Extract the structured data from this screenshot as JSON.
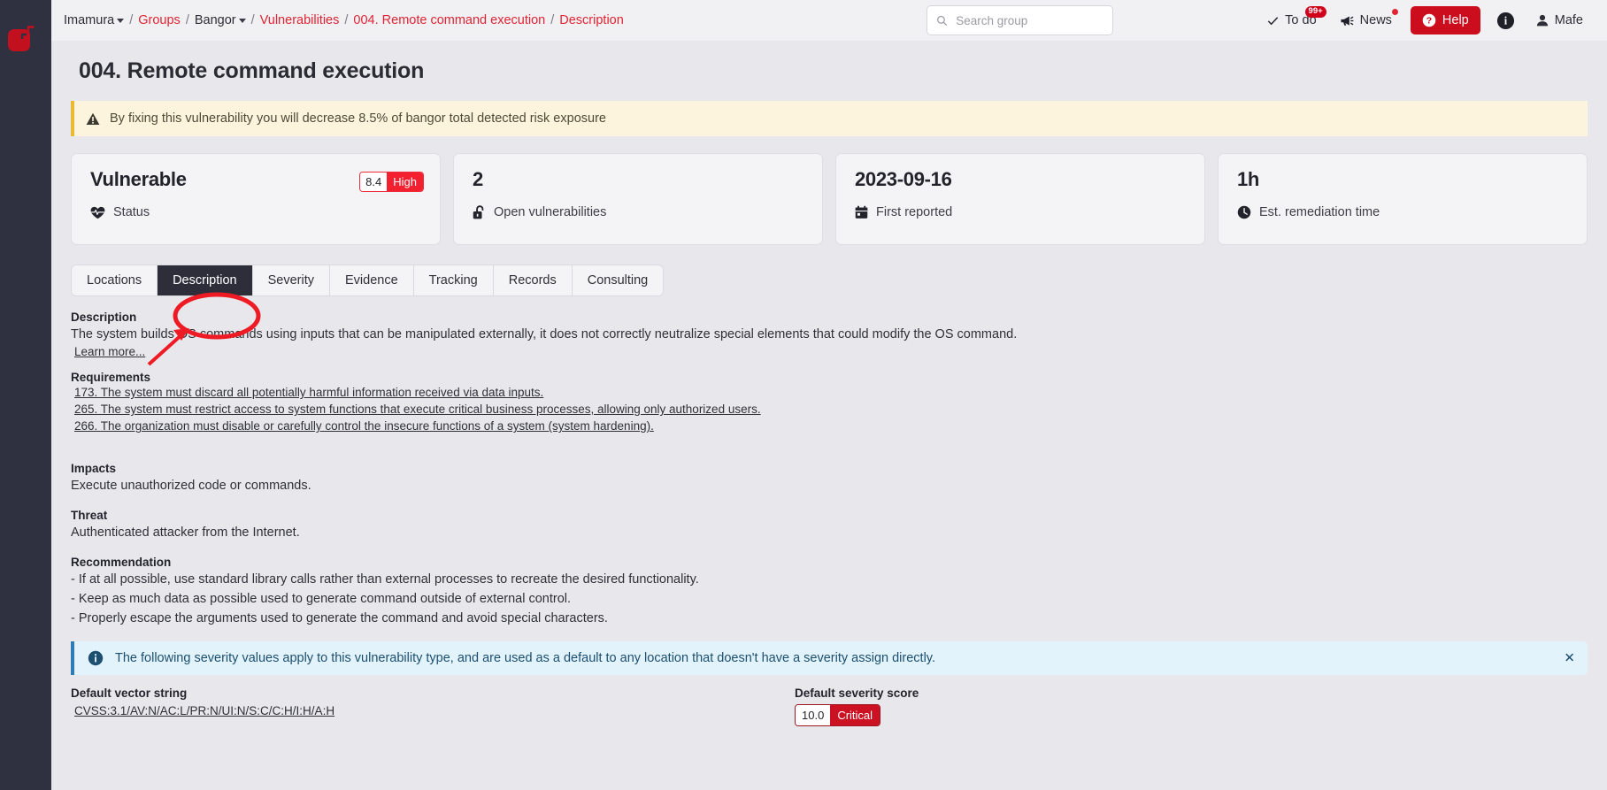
{
  "breadcrumb": {
    "items": [
      {
        "label": "Imamura",
        "link": false,
        "caret": true
      },
      {
        "label": "Groups",
        "link": true,
        "caret": false
      },
      {
        "label": "Bangor",
        "link": false,
        "caret": true
      },
      {
        "label": "Vulnerabilities",
        "link": true,
        "caret": false
      },
      {
        "label": "004. Remote command execution",
        "link": true,
        "caret": false
      },
      {
        "label": "Description",
        "link": true,
        "caret": false
      }
    ],
    "separator": "/"
  },
  "search": {
    "placeholder": "Search group",
    "value": "",
    "icon": "search-icon"
  },
  "tools": {
    "todo_label": "To do",
    "todo_badge": "99+",
    "news_label": "News",
    "help_label": "Help",
    "info_label": "",
    "user_label": "Mafe"
  },
  "page": {
    "title": "004. Remote command execution",
    "warning": "By fixing this vulnerability you will decrease 8.5% of bangor total detected risk exposure"
  },
  "cards": [
    {
      "value": "Vulnerable",
      "label": "Status",
      "icon": "heartbeat-icon",
      "pill": {
        "score": "8.4",
        "level": "High"
      }
    },
    {
      "value": "2",
      "label": "Open vulnerabilities",
      "icon": "unlock-icon"
    },
    {
      "value": "2023-09-16",
      "label": "First reported",
      "icon": "calendar-icon"
    },
    {
      "value": "1h",
      "label": "Est. remediation time",
      "icon": "clock-icon"
    }
  ],
  "tabs": [
    {
      "label": "Locations",
      "active": false
    },
    {
      "label": "Description",
      "active": true
    },
    {
      "label": "Severity",
      "active": false
    },
    {
      "label": "Evidence",
      "active": false
    },
    {
      "label": "Tracking",
      "active": false
    },
    {
      "label": "Records",
      "active": false
    },
    {
      "label": "Consulting",
      "active": false
    }
  ],
  "description": {
    "heading": "Description",
    "text": "The system builds OS commands using inputs that can be manipulated externally, it does not correctly neutralize special elements that could modify the OS command.",
    "learn_more": "Learn more...",
    "requirements_heading": "Requirements",
    "requirements": [
      "173. The system must discard all potentially harmful information received via data inputs.",
      "265. The system must restrict access to system functions that execute critical business processes, allowing only authorized users.",
      "266. The organization must disable or carefully control the insecure functions of a system (system hardening)."
    ],
    "impacts_heading": "Impacts",
    "impacts": "Execute unauthorized code or commands.",
    "threat_heading": "Threat",
    "threat": "Authenticated attacker from the Internet.",
    "recommendation_heading": "Recommendation",
    "recommendations": [
      "- If at all possible, use standard library calls rather than external processes to recreate the desired functionality.",
      "- Keep as much data as possible used to generate command outside of external control.",
      "- Properly escape the arguments used to generate the command and avoid special characters."
    ]
  },
  "severity_section": {
    "info": "The following severity values apply to this vulnerability type, and are used as a default to any location that doesn't have a severity assign directly.",
    "close": "✕",
    "vector_heading": "Default vector string",
    "vector_string": "CVSS:3.1/AV:N/AC:L/PR:N/UI:N/S:C/C:H/I:H/A:H",
    "score_heading": "Default severity score",
    "score": "10.0",
    "score_level": "Critical"
  },
  "colors": {
    "brand_red": "#e02433",
    "help_red": "#cc0d1e",
    "rail_dark": "#2f3040",
    "tab_active": "#2d2e3a",
    "warn_bg": "#fdf4dd",
    "warn_border": "#e8b931",
    "info_bg": "#e2f3fb",
    "info_border": "#2d7cb8",
    "annotation_red": "#ee1b24",
    "page_bg": "#e8e8ec",
    "critical": "#cc1122",
    "high": "#f3202f"
  }
}
